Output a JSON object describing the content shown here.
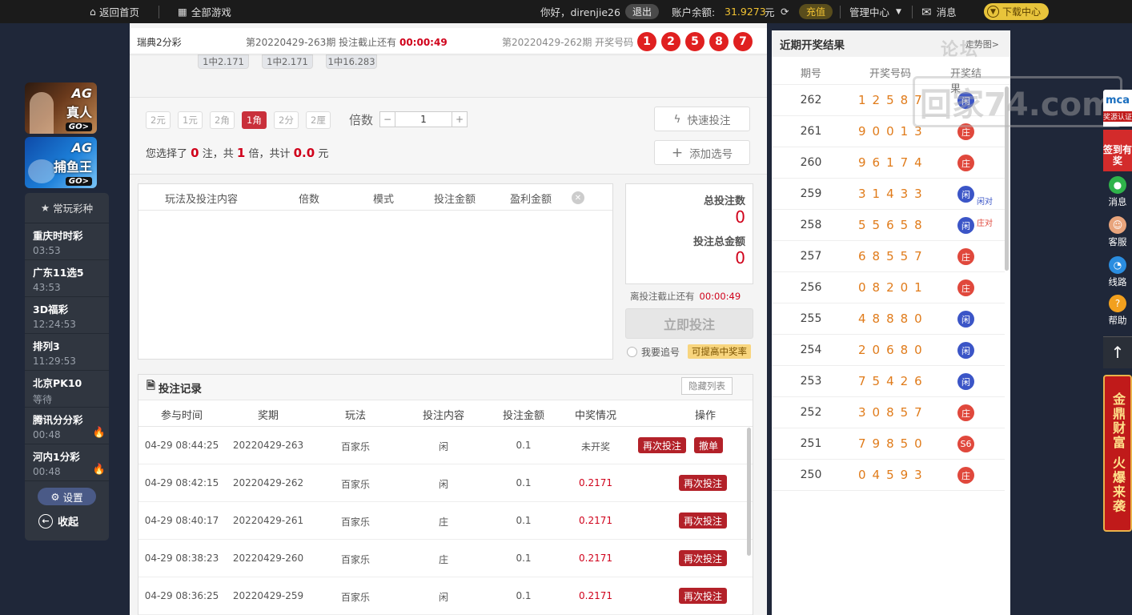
{
  "topbar": {
    "home": "返回首页",
    "all_games": "全部游戏",
    "greeting": "你好，direnjie26",
    "logout": "退出",
    "balance_label": "账户余额:",
    "balance": "31.9273",
    "currency": "元",
    "recharge": "充值",
    "manage": "管理中心",
    "messages": "消息",
    "download": "下载中心"
  },
  "sidebar": {
    "ag_live": {
      "brand": "AG",
      "name": "真人",
      "go": "GO>"
    },
    "ag_fish": {
      "brand": "AG",
      "name": "捕鱼王",
      "go": "GO>"
    },
    "header": "常玩彩种",
    "items": [
      {
        "name": "重庆时时彩",
        "time": "03:53",
        "hot": false
      },
      {
        "name": "广东11选5",
        "time": "43:53",
        "hot": false
      },
      {
        "name": "3D福彩",
        "time": "12:24:53",
        "hot": false
      },
      {
        "name": "排列3",
        "time": "11:29:53",
        "hot": false
      },
      {
        "name": "北京PK10",
        "time": "等待",
        "hot": false
      },
      {
        "name": "腾讯分分彩",
        "time": "00:48",
        "hot": true
      },
      {
        "name": "河内1分彩",
        "time": "00:48",
        "hot": true
      }
    ],
    "settings": "设置",
    "collapse": "收起"
  },
  "issue": {
    "game": "瑞典2分彩",
    "current_period": "第20220429-263期 投注截止还有",
    "countdown": "00:00:49",
    "prev_period": "第20220429-262期 开奖号码",
    "balls": [
      "1",
      "2",
      "5",
      "8",
      "7"
    ]
  },
  "odds": [
    "1中2.171",
    "1中2.171",
    "1中16.283"
  ],
  "units": [
    "2元",
    "1元",
    "2角",
    "1角",
    "2分",
    "2厘"
  ],
  "active_unit": "1角",
  "multiplier": {
    "label": "倍数",
    "value": "1",
    "minus": "−",
    "plus": "+"
  },
  "summary": {
    "p1": "您选择了",
    "notes": "0",
    "p2": "注，共",
    "times": "1",
    "p3": "倍，共计",
    "amount": "0.0",
    "p4": "元"
  },
  "quick_bet": "快速投注",
  "add_number": "添加选号",
  "slip_headers": [
    "玩法及投注内容",
    "倍数",
    "模式",
    "投注金额",
    "盈利金额"
  ],
  "totals": {
    "count_label": "总投注数",
    "count": "0",
    "amount_label": "投注总金额",
    "amount": "0"
  },
  "deadline": {
    "label": "离投注截止还有",
    "time": "00:00:49"
  },
  "bet_now": "立即投注",
  "chase": {
    "label": "我要追号",
    "tag": "可提高中奖率"
  },
  "records": {
    "title": "投注记录",
    "hide": "隐藏列表",
    "headers": [
      "参与时间",
      "奖期",
      "玩法",
      "投注内容",
      "投注金额",
      "中奖情况",
      "操作"
    ],
    "rows": [
      {
        "time": "04-29 08:44:25",
        "period": "20220429-263",
        "play": "百家乐",
        "content": "闲",
        "amount": "0.1",
        "result": "未开奖",
        "win": false,
        "rebet": "再次投注",
        "cancel": "撤单"
      },
      {
        "time": "04-29 08:42:15",
        "period": "20220429-262",
        "play": "百家乐",
        "content": "闲",
        "amount": "0.1",
        "result": "0.2171",
        "win": true,
        "rebet": "再次投注",
        "cancel": ""
      },
      {
        "time": "04-29 08:40:17",
        "period": "20220429-261",
        "play": "百家乐",
        "content": "庄",
        "amount": "0.1",
        "result": "0.2171",
        "win": true,
        "rebet": "再次投注",
        "cancel": ""
      },
      {
        "time": "04-29 08:38:23",
        "period": "20220429-260",
        "play": "百家乐",
        "content": "庄",
        "amount": "0.1",
        "result": "0.2171",
        "win": true,
        "rebet": "再次投注",
        "cancel": ""
      },
      {
        "time": "04-29 08:36:25",
        "period": "20220429-259",
        "play": "百家乐",
        "content": "闲",
        "amount": "0.1",
        "result": "0.2171",
        "win": true,
        "rebet": "再次投注",
        "cancel": ""
      }
    ]
  },
  "results": {
    "title": "近期开奖结果",
    "trend": "走势图>",
    "headers": [
      "期号",
      "开奖号码",
      "开奖结果"
    ],
    "rows": [
      {
        "period": "262",
        "nums": "12587",
        "res": "闲",
        "color": "blue",
        "note": ""
      },
      {
        "period": "261",
        "nums": "90013",
        "res": "庄",
        "color": "red",
        "note": ""
      },
      {
        "period": "260",
        "nums": "96174",
        "res": "庄",
        "color": "red",
        "note": ""
      },
      {
        "period": "259",
        "nums": "31433",
        "res": "闲",
        "color": "blue",
        "note": "闲对"
      },
      {
        "period": "258",
        "nums": "55658",
        "res": "闲",
        "color": "blue",
        "note": "庄对"
      },
      {
        "period": "257",
        "nums": "68557",
        "res": "庄",
        "color": "red",
        "note": ""
      },
      {
        "period": "256",
        "nums": "08201",
        "res": "庄",
        "color": "red",
        "note": ""
      },
      {
        "period": "255",
        "nums": "48880",
        "res": "闲",
        "color": "blue",
        "note": ""
      },
      {
        "period": "254",
        "nums": "20680",
        "res": "闲",
        "color": "blue",
        "note": ""
      },
      {
        "period": "253",
        "nums": "75426",
        "res": "闲",
        "color": "blue",
        "note": ""
      },
      {
        "period": "252",
        "nums": "30857",
        "res": "庄",
        "color": "red",
        "note": ""
      },
      {
        "period": "251",
        "nums": "79850",
        "res": "S6",
        "color": "red",
        "note": ""
      },
      {
        "period": "250",
        "nums": "04593",
        "res": "庄",
        "color": "red",
        "note": ""
      }
    ]
  },
  "watermark": {
    "top": "论坛",
    "main": "回家74.com"
  },
  "float_bar": {
    "brand": "mca",
    "brand_sub": "奖源认证",
    "signin": "签到有奖",
    "message": "消息",
    "service": "客服",
    "route": "线路",
    "help": "帮助",
    "top": "↑",
    "banner": "金鼎财富 火爆来袭"
  },
  "colors": {
    "accent_red": "#c9303b",
    "gold": "#f1c232",
    "result_blue": "#3b55c7",
    "result_red": "#e0483c",
    "number_orange": "#e07b1a"
  }
}
